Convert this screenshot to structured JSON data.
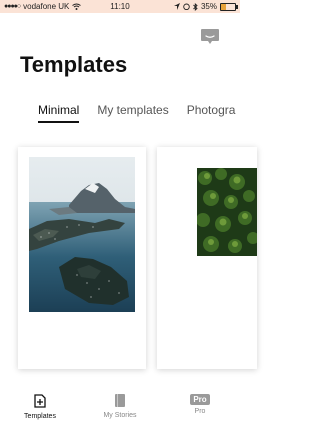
{
  "status": {
    "carrier": "vodafone UK",
    "time": "11:10",
    "battery_percent": "35%",
    "battery_level": 0.35
  },
  "header": {
    "title": "Templates"
  },
  "tabs": [
    {
      "label": "Minimal",
      "active": true
    },
    {
      "label": "My templates",
      "active": false
    },
    {
      "label": "Photogra",
      "active": false
    }
  ],
  "bottom_nav": {
    "templates": "Templates",
    "stories": "My Stories",
    "pro": "Pro",
    "pro_badge": "Pro"
  },
  "colors": {
    "status_bar": "#fbe3d6",
    "accent": "#111111",
    "inactive": "#888888"
  }
}
